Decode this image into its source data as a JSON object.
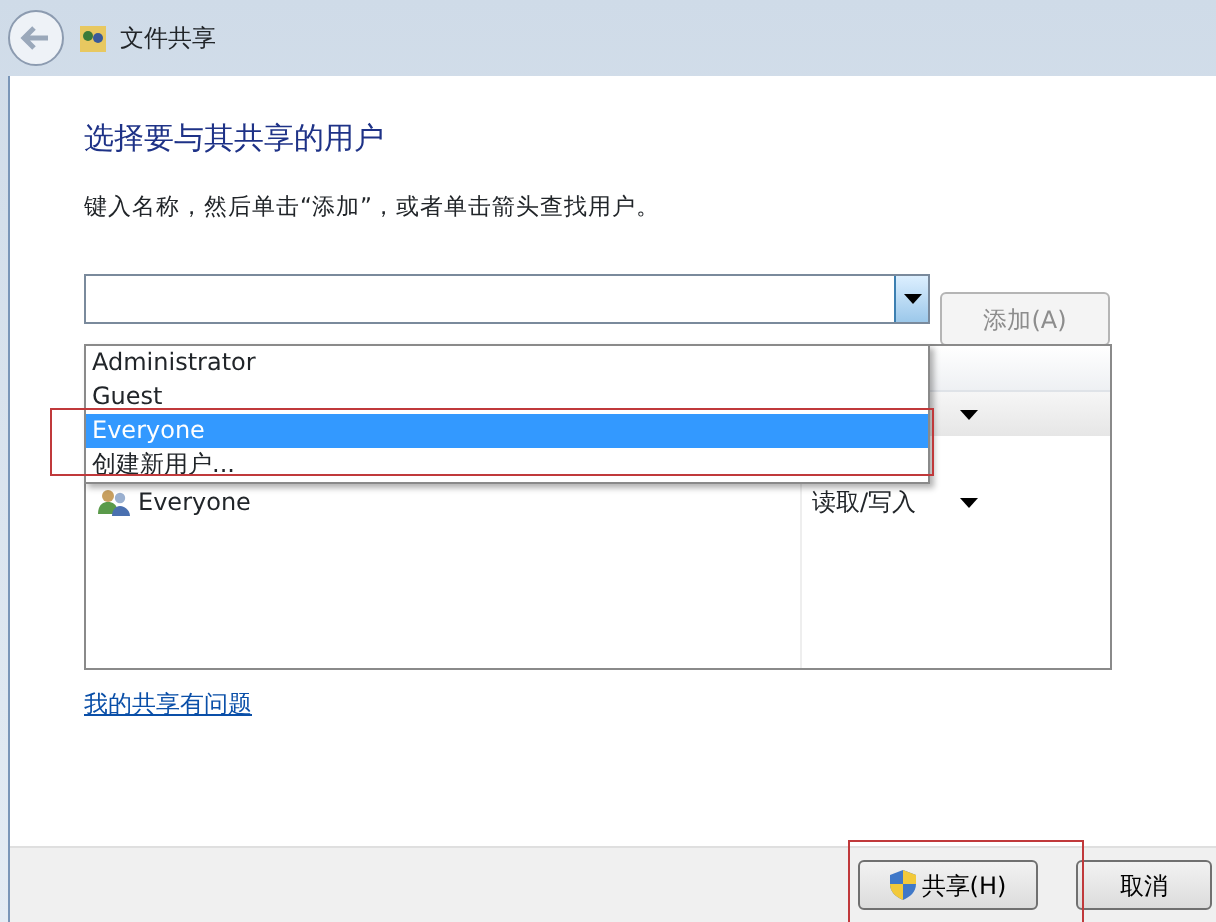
{
  "window": {
    "title": "文件共享"
  },
  "heading": "选择要与其共享的用户",
  "instruction": "键入名称，然后单击“添加”，或者单击箭头查找用户。",
  "name_field": {
    "expanded": true
  },
  "add_button": {
    "label": "添加(A)",
    "disabled": true
  },
  "dropdown": {
    "items": [
      {
        "label": "Administrator",
        "selected": false,
        "highlighted": false
      },
      {
        "label": "Guest",
        "selected": false,
        "highlighted": false
      },
      {
        "label": "Everyone",
        "selected": true,
        "highlighted": true
      },
      {
        "label": "创建新用户...",
        "selected": false,
        "highlighted": false
      }
    ]
  },
  "table": {
    "rows": [
      {
        "selected": true,
        "has_menu": true
      },
      {
        "name": "Everyone",
        "permission": "读取/写入",
        "selected": false,
        "has_menu": true
      }
    ]
  },
  "help_link": "我的共享有问题",
  "buttons": [
    {
      "kind": "shield",
      "label": "共享(H)",
      "highlighted": true
    },
    {
      "kind": "plain",
      "label": "取消",
      "highlighted": false
    }
  ]
}
